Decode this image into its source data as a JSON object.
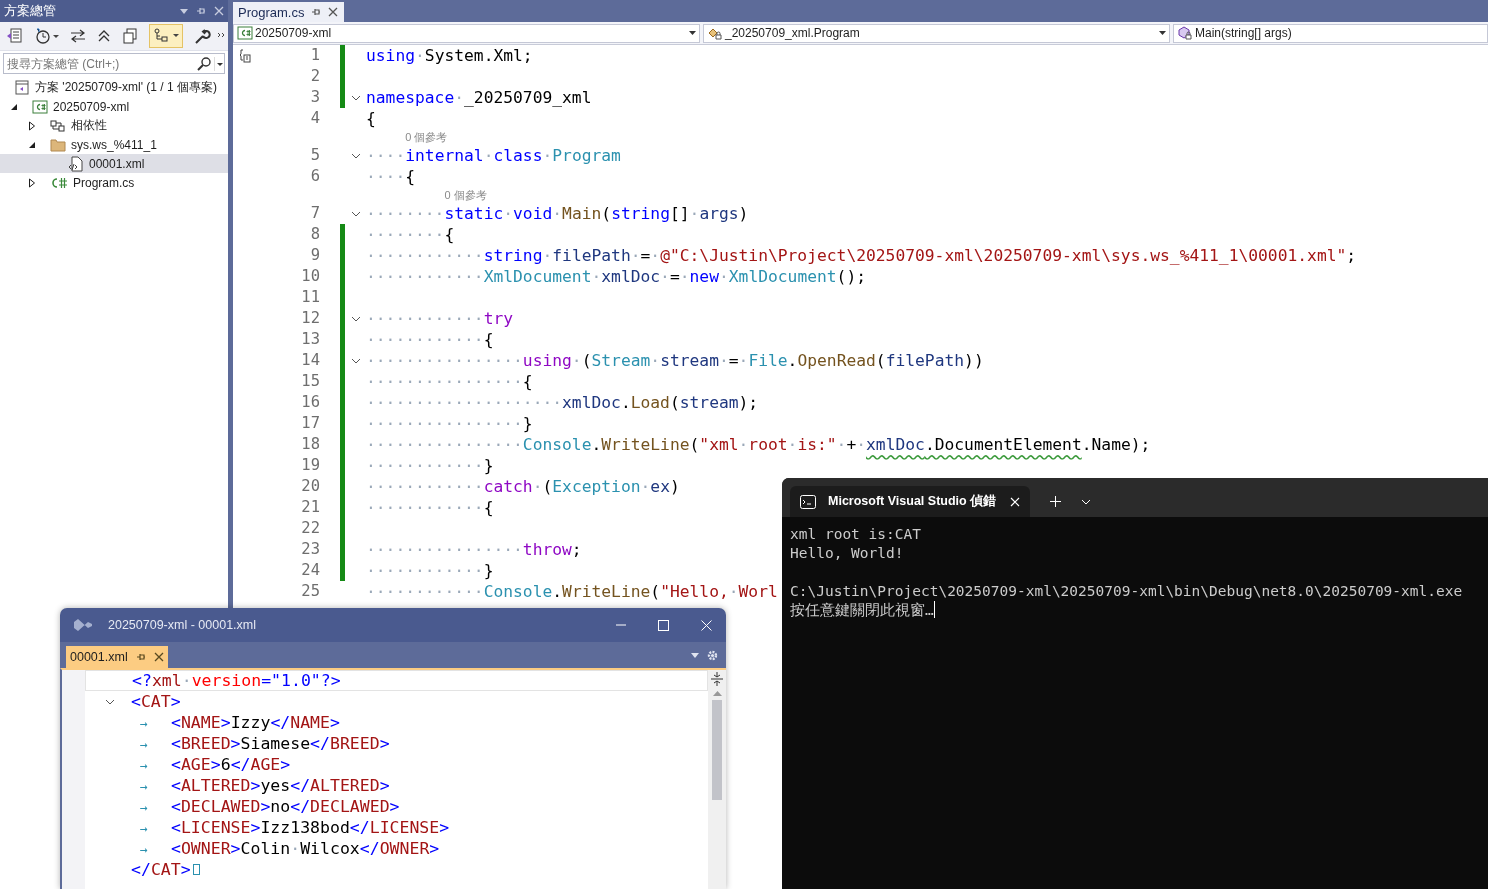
{
  "solution_explorer": {
    "title": "方案總管",
    "toolbar": [
      {
        "kind": "solution",
        "pressed": false
      },
      {
        "kind": "history",
        "pressed": false
      },
      {
        "kind": "sync",
        "pressed": false
      },
      {
        "kind": "collapse",
        "pressed": false
      },
      {
        "kind": "copy",
        "pressed": false
      },
      {
        "kind": "tree",
        "pressed": true
      },
      {
        "kind": "properties",
        "pressed": false
      }
    ],
    "search": {
      "placeholder": "搜尋方案總管 (Ctrl+;)"
    },
    "tree": [
      {
        "kind": "solution",
        "label": "方案 '20250709-xml' (1 / 1 個專案)",
        "selected": false,
        "children": [
          {
            "kind": "project",
            "label": "20250709-xml",
            "expanded": true,
            "selected": false,
            "children": [
              {
                "kind": "dependencies",
                "label": "相依性",
                "expanded": false,
                "selected": false
              },
              {
                "kind": "folder",
                "label": "sys.ws_%411_1",
                "expanded": true,
                "selected": false,
                "children": [
                  {
                    "kind": "xml",
                    "label": "00001.xml",
                    "selected": true
                  }
                ]
              },
              {
                "kind": "csharp",
                "label": "Program.cs",
                "expanded": false,
                "selected": false
              }
            ]
          }
        ]
      }
    ]
  },
  "editor": {
    "tabs": [
      {
        "label": "Program.cs",
        "selected": true
      }
    ],
    "nav": [
      {
        "kind": "project",
        "label": "20250709-xml"
      },
      {
        "kind": "class",
        "label": "_20250709_xml.Program"
      },
      {
        "kind": "method",
        "label": "Main(string[] args)"
      }
    ],
    "lines": [
      {
        "kind": "code",
        "num": "1",
        "changed": true,
        "tokens": [
          {
            "kind": "keyword",
            "text": "using"
          },
          {
            "kind": "plain",
            "text": "·System.Xml;"
          }
        ]
      },
      {
        "kind": "code",
        "num": "2",
        "changed": true
      },
      {
        "kind": "code",
        "num": "3",
        "changed": true,
        "fold_expanded": true,
        "tokens": [
          {
            "kind": "keyword",
            "text": "namespace"
          },
          {
            "kind": "plain",
            "text": "·_20250709_xml"
          }
        ]
      },
      {
        "kind": "code",
        "num": "4",
        "changed": false,
        "tokens": [
          {
            "kind": "plain",
            "text": "{"
          }
        ]
      },
      {
        "kind": "codelens",
        "text": "0 個參考"
      },
      {
        "kind": "code",
        "num": "5",
        "changed": false,
        "fold_expanded": true,
        "tokens": [
          {
            "kind": "plain",
            "text": "····"
          },
          {
            "kind": "keyword",
            "text": "internal"
          },
          {
            "kind": "plain",
            "text": "·"
          },
          {
            "kind": "keyword",
            "text": "class"
          },
          {
            "kind": "plain",
            "text": "·"
          },
          {
            "kind": "type",
            "text": "Program"
          }
        ]
      },
      {
        "kind": "code",
        "num": "6",
        "changed": false,
        "tokens": [
          {
            "kind": "plain",
            "text": "····{"
          }
        ]
      },
      {
        "kind": "codelens",
        "text": "0 個參考"
      },
      {
        "kind": "code",
        "num": "7",
        "changed": false,
        "fold_expanded": true,
        "tokens": [
          {
            "kind": "plain",
            "text": "········"
          },
          {
            "kind": "keyword",
            "text": "static"
          },
          {
            "kind": "plain",
            "text": "·"
          },
          {
            "kind": "keyword",
            "text": "void"
          },
          {
            "kind": "plain",
            "text": "·"
          },
          {
            "kind": "method",
            "text": "Main"
          },
          {
            "kind": "plain",
            "text": "("
          },
          {
            "kind": "keyword",
            "text": "string"
          },
          {
            "kind": "plain",
            "text": "[]·"
          },
          {
            "kind": "variable",
            "text": "args"
          },
          {
            "kind": "plain",
            "text": ")"
          }
        ]
      },
      {
        "kind": "code",
        "num": "8",
        "changed": true,
        "tokens": [
          {
            "kind": "plain",
            "text": "········{"
          }
        ]
      },
      {
        "kind": "code",
        "num": "9",
        "changed": true,
        "tokens": [
          {
            "kind": "plain",
            "text": "············"
          },
          {
            "kind": "keyword",
            "text": "string"
          },
          {
            "kind": "plain",
            "text": "·"
          },
          {
            "kind": "variable",
            "text": "filePath"
          },
          {
            "kind": "plain",
            "text": "·=·"
          },
          {
            "kind": "string",
            "text": "@\"C:\\Justin\\Project\\20250709-xml\\20250709-xml\\sys.ws_%411_1\\00001.xml\""
          },
          {
            "kind": "plain",
            "text": ";"
          }
        ]
      },
      {
        "kind": "code",
        "num": "10",
        "changed": true,
        "tokens": [
          {
            "kind": "plain",
            "text": "············"
          },
          {
            "kind": "type",
            "text": "XmlDocument"
          },
          {
            "kind": "plain",
            "text": "·"
          },
          {
            "kind": "variable",
            "text": "xmlDoc"
          },
          {
            "kind": "plain",
            "text": "·=·"
          },
          {
            "kind": "keyword",
            "text": "new"
          },
          {
            "kind": "plain",
            "text": "·"
          },
          {
            "kind": "type",
            "text": "XmlDocument"
          },
          {
            "kind": "plain",
            "text": "();"
          }
        ]
      },
      {
        "kind": "code",
        "num": "11",
        "changed": true
      },
      {
        "kind": "code",
        "num": "12",
        "changed": true,
        "fold_expanded": true,
        "tokens": [
          {
            "kind": "plain",
            "text": "············"
          },
          {
            "kind": "control",
            "text": "try"
          }
        ]
      },
      {
        "kind": "code",
        "num": "13",
        "changed": true,
        "tokens": [
          {
            "kind": "plain",
            "text": "············{"
          }
        ]
      },
      {
        "kind": "code",
        "num": "14",
        "changed": true,
        "fold_expanded": true,
        "tokens": [
          {
            "kind": "plain",
            "text": "················"
          },
          {
            "kind": "control",
            "text": "using"
          },
          {
            "kind": "plain",
            "text": "·("
          },
          {
            "kind": "type",
            "text": "Stream"
          },
          {
            "kind": "plain",
            "text": "·"
          },
          {
            "kind": "variable",
            "text": "stream"
          },
          {
            "kind": "plain",
            "text": "·=·"
          },
          {
            "kind": "type",
            "text": "File"
          },
          {
            "kind": "plain",
            "text": "."
          },
          {
            "kind": "method",
            "text": "OpenRead"
          },
          {
            "kind": "plain",
            "text": "("
          },
          {
            "kind": "variable",
            "text": "filePath"
          },
          {
            "kind": "plain",
            "text": "))"
          }
        ]
      },
      {
        "kind": "code",
        "num": "15",
        "changed": true,
        "tokens": [
          {
            "kind": "plain",
            "text": "················{"
          }
        ]
      },
      {
        "kind": "code",
        "num": "16",
        "changed": true,
        "tokens": [
          {
            "kind": "plain",
            "text": "····················"
          },
          {
            "kind": "variable",
            "text": "xmlDoc"
          },
          {
            "kind": "plain",
            "text": "."
          },
          {
            "kind": "method",
            "text": "Load"
          },
          {
            "kind": "plain",
            "text": "("
          },
          {
            "kind": "variable",
            "text": "stream"
          },
          {
            "kind": "plain",
            "text": ");"
          }
        ]
      },
      {
        "kind": "code",
        "num": "17",
        "changed": true,
        "tokens": [
          {
            "kind": "plain",
            "text": "················}"
          }
        ]
      },
      {
        "kind": "code",
        "num": "18",
        "changed": true,
        "tokens": [
          {
            "kind": "plain",
            "text": "················"
          },
          {
            "kind": "type",
            "text": "Console"
          },
          {
            "kind": "plain",
            "text": "."
          },
          {
            "kind": "method",
            "text": "WriteLine"
          },
          {
            "kind": "plain",
            "text": "("
          },
          {
            "kind": "string",
            "text": "\"xml·root·is:\""
          },
          {
            "kind": "plain",
            "text": "·+·"
          },
          {
            "kind": "variable",
            "text": "xmlDoc",
            "squiggle": true
          },
          {
            "kind": "plain",
            "text": ".DocumentElement",
            "squiggle": true
          },
          {
            "kind": "plain",
            "text": ".Name);"
          }
        ]
      },
      {
        "kind": "code",
        "num": "19",
        "changed": true,
        "tokens": [
          {
            "kind": "plain",
            "text": "············}"
          }
        ]
      },
      {
        "kind": "code",
        "num": "20",
        "changed": true,
        "tokens": [
          {
            "kind": "plain",
            "text": "············"
          },
          {
            "kind": "control",
            "text": "catch"
          },
          {
            "kind": "plain",
            "text": "·("
          },
          {
            "kind": "type",
            "text": "Exception"
          },
          {
            "kind": "plain",
            "text": "·"
          },
          {
            "kind": "variable",
            "text": "ex"
          },
          {
            "kind": "plain",
            "text": ")"
          }
        ]
      },
      {
        "kind": "code",
        "num": "21",
        "changed": true,
        "tokens": [
          {
            "kind": "plain",
            "text": "············{"
          }
        ]
      },
      {
        "kind": "code",
        "num": "22",
        "changed": true
      },
      {
        "kind": "code",
        "num": "23",
        "changed": true,
        "tokens": [
          {
            "kind": "plain",
            "text": "················"
          },
          {
            "kind": "control",
            "text": "throw"
          },
          {
            "kind": "plain",
            "text": ";"
          }
        ]
      },
      {
        "kind": "code",
        "num": "24",
        "changed": true,
        "tokens": [
          {
            "kind": "plain",
            "text": "············}"
          }
        ]
      },
      {
        "kind": "code",
        "num": "25",
        "changed": false,
        "tokens": [
          {
            "kind": "plain",
            "text": "············"
          },
          {
            "kind": "type",
            "text": "Console"
          },
          {
            "kind": "plain",
            "text": "."
          },
          {
            "kind": "method",
            "text": "WriteLine"
          },
          {
            "kind": "plain",
            "text": "("
          },
          {
            "kind": "string",
            "text": "\"Hello,·Worl"
          }
        ]
      }
    ]
  },
  "xml_window": {
    "title": "20250709-xml - 00001.xml",
    "tabs": [
      {
        "label": "00001.xml",
        "selected": true
      }
    ],
    "lines": [
      {
        "current": true,
        "tokens": [
          {
            "kind": "delim",
            "text": "<?"
          },
          {
            "kind": "name",
            "text": "xml"
          },
          {
            "kind": "plain",
            "text": "·"
          },
          {
            "kind": "attr",
            "text": "version"
          },
          {
            "kind": "delim",
            "text": "=\"1.0\"?>"
          }
        ]
      },
      {
        "current": false,
        "fold_expanded": true,
        "tokens": [
          {
            "kind": "delim",
            "text": "<"
          },
          {
            "kind": "name",
            "text": "CAT"
          },
          {
            "kind": "delim",
            "text": ">"
          }
        ]
      },
      {
        "current": false,
        "tokens": [
          {
            "kind": "tab",
            "text": "→"
          },
          {
            "kind": "delim",
            "text": "<"
          },
          {
            "kind": "name",
            "text": "NAME"
          },
          {
            "kind": "delim",
            "text": ">"
          },
          {
            "kind": "plain",
            "text": "Izzy"
          },
          {
            "kind": "delim",
            "text": "</"
          },
          {
            "kind": "name",
            "text": "NAME"
          },
          {
            "kind": "delim",
            "text": ">"
          }
        ]
      },
      {
        "current": false,
        "tokens": [
          {
            "kind": "tab",
            "text": "→"
          },
          {
            "kind": "delim",
            "text": "<"
          },
          {
            "kind": "name",
            "text": "BREED"
          },
          {
            "kind": "delim",
            "text": ">"
          },
          {
            "kind": "plain",
            "text": "Siamese"
          },
          {
            "kind": "delim",
            "text": "</"
          },
          {
            "kind": "name",
            "text": "BREED"
          },
          {
            "kind": "delim",
            "text": ">"
          }
        ]
      },
      {
        "current": false,
        "tokens": [
          {
            "kind": "tab",
            "text": "→"
          },
          {
            "kind": "delim",
            "text": "<"
          },
          {
            "kind": "name",
            "text": "AGE"
          },
          {
            "kind": "delim",
            "text": ">"
          },
          {
            "kind": "plain",
            "text": "6"
          },
          {
            "kind": "delim",
            "text": "</"
          },
          {
            "kind": "name",
            "text": "AGE"
          },
          {
            "kind": "delim",
            "text": ">"
          }
        ]
      },
      {
        "current": false,
        "tokens": [
          {
            "kind": "tab",
            "text": "→"
          },
          {
            "kind": "delim",
            "text": "<"
          },
          {
            "kind": "name",
            "text": "ALTERED"
          },
          {
            "kind": "delim",
            "text": ">"
          },
          {
            "kind": "plain",
            "text": "yes"
          },
          {
            "kind": "delim",
            "text": "</"
          },
          {
            "kind": "name",
            "text": "ALTERED"
          },
          {
            "kind": "delim",
            "text": ">"
          }
        ]
      },
      {
        "current": false,
        "tokens": [
          {
            "kind": "tab",
            "text": "→"
          },
          {
            "kind": "delim",
            "text": "<"
          },
          {
            "kind": "name",
            "text": "DECLAWED"
          },
          {
            "kind": "delim",
            "text": ">"
          },
          {
            "kind": "plain",
            "text": "no"
          },
          {
            "kind": "delim",
            "text": "</"
          },
          {
            "kind": "name",
            "text": "DECLAWED"
          },
          {
            "kind": "delim",
            "text": ">"
          }
        ]
      },
      {
        "current": false,
        "tokens": [
          {
            "kind": "tab",
            "text": "→"
          },
          {
            "kind": "delim",
            "text": "<"
          },
          {
            "kind": "name",
            "text": "LICENSE"
          },
          {
            "kind": "delim",
            "text": ">"
          },
          {
            "kind": "plain",
            "text": "Izz138bod"
          },
          {
            "kind": "delim",
            "text": "</"
          },
          {
            "kind": "name",
            "text": "LICENSE"
          },
          {
            "kind": "delim",
            "text": ">"
          }
        ]
      },
      {
        "current": false,
        "tokens": [
          {
            "kind": "tab",
            "text": "→"
          },
          {
            "kind": "delim",
            "text": "<"
          },
          {
            "kind": "name",
            "text": "OWNER"
          },
          {
            "kind": "delim",
            "text": ">"
          },
          {
            "kind": "plain",
            "text": "Colin·Wilcox"
          },
          {
            "kind": "delim",
            "text": "</"
          },
          {
            "kind": "name",
            "text": "OWNER"
          },
          {
            "kind": "delim",
            "text": ">"
          }
        ]
      },
      {
        "current": false,
        "eof": true,
        "tokens": [
          {
            "kind": "delim",
            "text": "</"
          },
          {
            "kind": "name",
            "text": "CAT"
          },
          {
            "kind": "delim",
            "text": ">"
          }
        ]
      }
    ]
  },
  "console": {
    "tab_title": "Microsoft Visual Studio 偵錯",
    "output": [
      "xml root is:CAT",
      "Hello, World!"
    ],
    "exit_message": [
      "C:\\Justin\\Project\\20250709-xml\\20250709-xml\\bin\\Debug\\net8.0\\20250709-xml.exe",
      "按任意鍵關閉此視窗…"
    ],
    "cursor": true
  }
}
